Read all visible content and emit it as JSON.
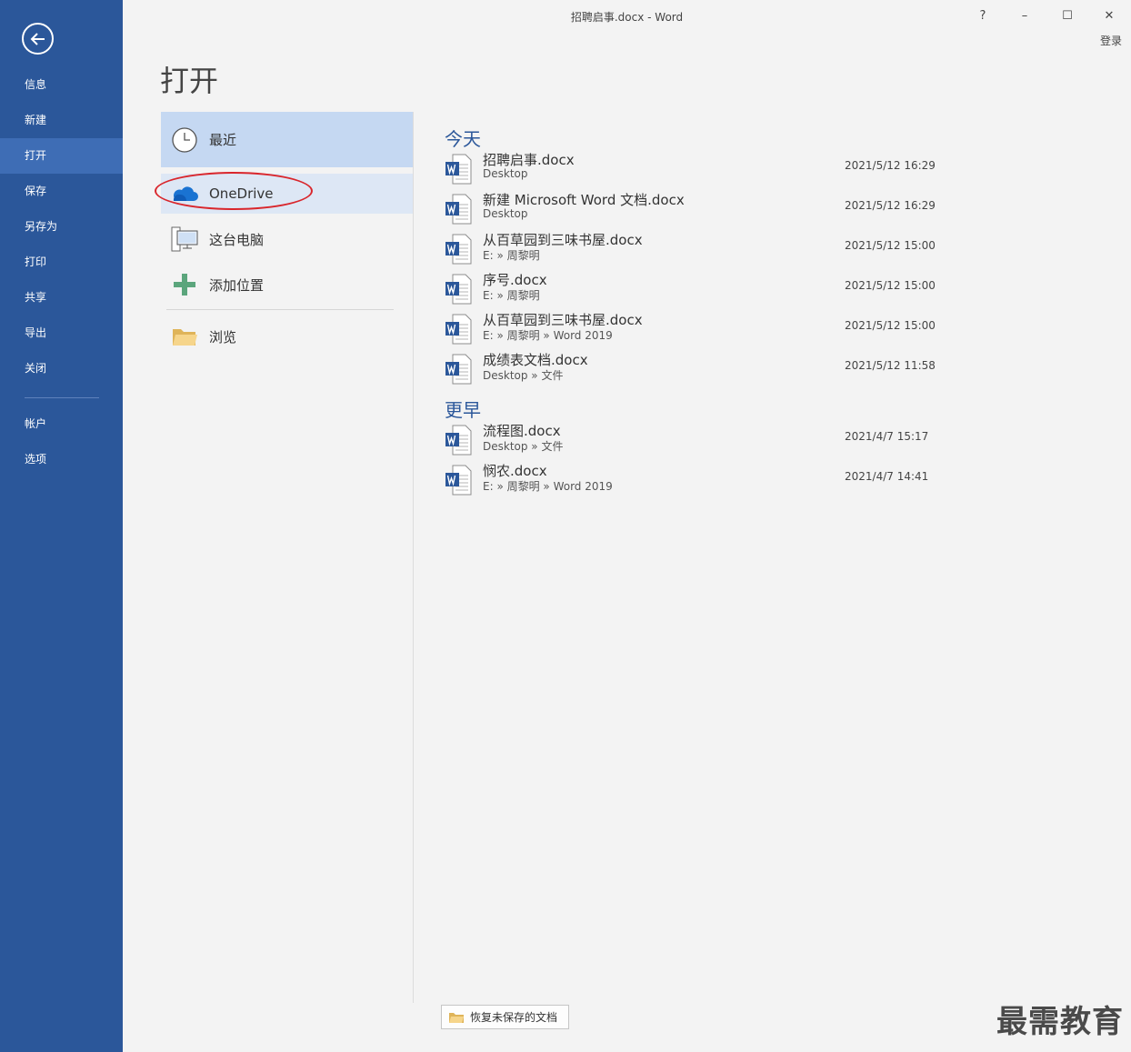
{
  "window": {
    "title": "招聘启事.docx - Word",
    "help": "?",
    "minimize": "–",
    "maximize": "☐",
    "close": "✕",
    "signin": "登录"
  },
  "nav": {
    "items": [
      {
        "label": "信息"
      },
      {
        "label": "新建"
      },
      {
        "label": "打开"
      },
      {
        "label": "保存"
      },
      {
        "label": "另存为"
      },
      {
        "label": "打印"
      },
      {
        "label": "共享"
      },
      {
        "label": "导出"
      },
      {
        "label": "关闭"
      },
      {
        "label": "帐户"
      },
      {
        "label": "选项"
      }
    ],
    "active": "打开",
    "accent": "#2b579a"
  },
  "page_title": "打开",
  "places": [
    {
      "label": "最近",
      "icon": "clock-icon"
    },
    {
      "label": "OneDrive",
      "icon": "cloud-icon"
    },
    {
      "label": "这台电脑",
      "icon": "computer-icon"
    },
    {
      "label": "添加位置",
      "icon": "plus-icon"
    },
    {
      "label": "浏览",
      "icon": "folder-icon"
    }
  ],
  "sections": {
    "today": "今天",
    "earlier": "更早"
  },
  "files": [
    {
      "name": "招聘启事.docx",
      "path": "Desktop",
      "date": "2021/5/12 16:29"
    },
    {
      "name": "新建 Microsoft Word 文档.docx",
      "path": "Desktop",
      "date": "2021/5/12 16:29"
    },
    {
      "name": "从百草园到三味书屋.docx",
      "path": "E: » 周黎明",
      "date": "2021/5/12 15:00"
    },
    {
      "name": "序号.docx",
      "path": "E: » 周黎明",
      "date": "2021/5/12 15:00"
    },
    {
      "name": "从百草园到三味书屋.docx",
      "path": "E: » 周黎明 » Word 2019",
      "date": "2021/5/12 15:00"
    },
    {
      "name": "成绩表文档.docx",
      "path": "Desktop » 文件",
      "date": "2021/5/12 11:58"
    },
    {
      "name": "流程图.docx",
      "path": "Desktop » 文件",
      "date": "2021/4/7 15:17"
    },
    {
      "name": "悯农.docx",
      "path": "E: » 周黎明 » Word 2019",
      "date": "2021/4/7 14:41"
    }
  ],
  "recover_button": "恢复未保存的文档",
  "watermark": "最需教育"
}
